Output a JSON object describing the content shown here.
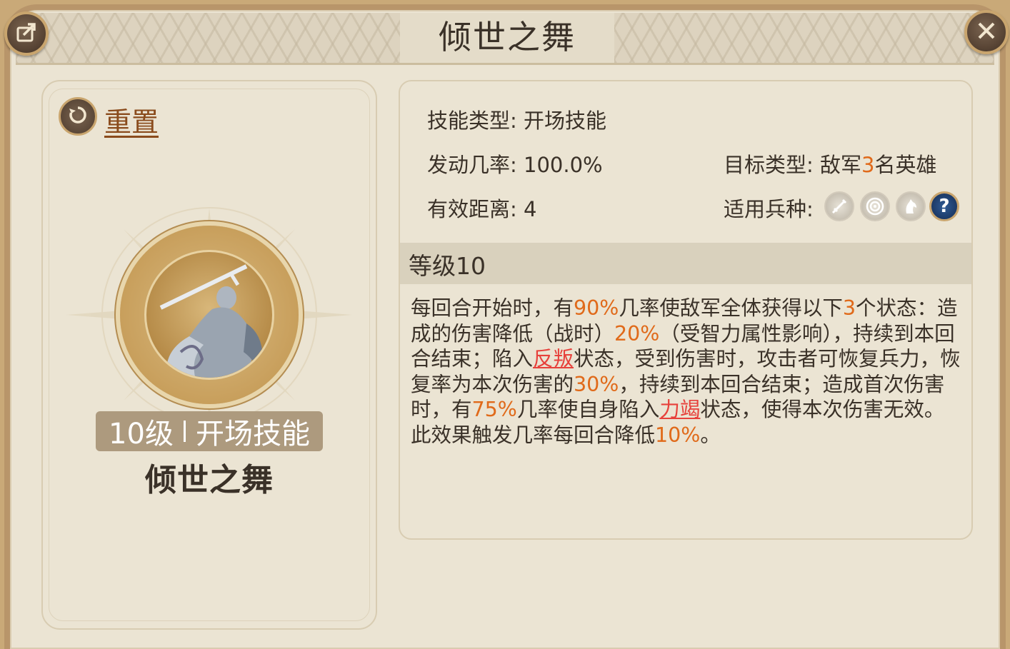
{
  "window": {
    "title": "倾世之舞"
  },
  "left": {
    "reset_label": "重置",
    "level_text": "10级",
    "skill_kind": "开场技能",
    "skill_name": "倾世之舞"
  },
  "info": {
    "type_label": "技能类型:",
    "type_value": "开场技能",
    "rate_label": "发动几率:",
    "rate_value": "100.0%",
    "range_label": "有效距离:",
    "range_value": "4",
    "target_label": "目标类型:",
    "target_prefix": "敌军",
    "target_count": "3",
    "target_suffix": "名英雄",
    "troops_label": "适用兵种:",
    "troop_icons": [
      "sword-icon",
      "target-icon",
      "horse-icon",
      "question-icon"
    ],
    "question_mark": "?"
  },
  "level_header": "等级10",
  "description": {
    "p1": "每回合开始时，有",
    "v1": "90%",
    "p2": "几率使敌军全体获得以下",
    "v2": "3",
    "p3": "个状态：造成的伤害降低（战时）",
    "v3": "20%",
    "p4": "（受智力属性影响），持续到本回合结束；陷入",
    "r1": "反叛",
    "p5": "状态，受到伤害时，攻击者可恢复兵力，恢复率为本次伤害的",
    "v4": "30%",
    "p6": "，持续到本回合结束；造成首次伤害时，有",
    "v5": "75%",
    "p7": "几率使自身陷入",
    "r2": "力竭",
    "p8": "状态，使得本次伤害无效。此效果触发几率每回合降低",
    "v6": "10%",
    "p9": "。"
  },
  "colors": {
    "highlight": "#e06a1a",
    "status_link": "#e7413b",
    "panel_bg": "#ebe4d3",
    "frame": "#b8956a"
  }
}
